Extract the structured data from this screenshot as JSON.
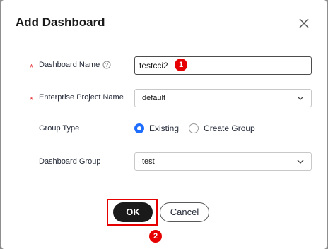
{
  "dialog": {
    "title": "Add Dashboard"
  },
  "form": {
    "dashboard_name": {
      "label": "Dashboard Name",
      "required_mark": "*",
      "value": "testcci2"
    },
    "enterprise_project": {
      "label": "Enterprise Project Name",
      "required_mark": "*",
      "value": "default"
    },
    "group_type": {
      "label": "Group Type",
      "options": [
        "Existing",
        "Create Group"
      ],
      "selected": "Existing"
    },
    "dashboard_group": {
      "label": "Dashboard Group",
      "value": "test"
    }
  },
  "buttons": {
    "ok": "OK",
    "cancel": "Cancel"
  },
  "annotations": {
    "step1": "1",
    "step2": "2"
  },
  "colors": {
    "accent": "#1f6dff",
    "primary_button": "#1a1a1a",
    "required": "#e6383c",
    "annotation": "#e60000"
  }
}
